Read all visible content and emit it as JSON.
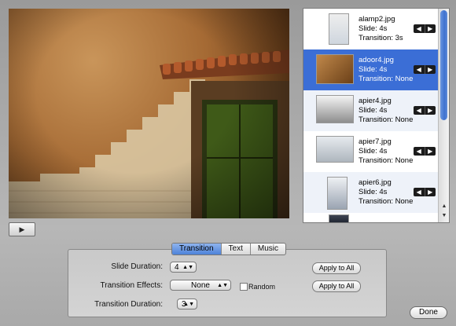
{
  "slides": [
    {
      "name": "alamp2.jpg",
      "slide": "Slide: 4s",
      "transition": "Transition: 3s",
      "selected": false
    },
    {
      "name": "adoor4.jpg",
      "slide": "Slide: 4s",
      "transition": "Transition: None",
      "selected": true
    },
    {
      "name": "apier4.jpg",
      "slide": "Slide: 4s",
      "transition": "Transition: None",
      "selected": false
    },
    {
      "name": "apier7.jpg",
      "slide": "Slide: 4s",
      "transition": "Transition: None",
      "selected": false
    },
    {
      "name": "apier6.jpg",
      "slide": "Slide: 4s",
      "transition": "Transition: None",
      "selected": false
    }
  ],
  "arrow_left": "◀",
  "arrow_right": "▶",
  "tabs": [
    "Transition",
    "Text",
    "Music"
  ],
  "active_tab": "Transition",
  "settings": {
    "slide_duration_label": "Slide Duration:",
    "slide_duration_value": "4",
    "transition_effects_label": "Transition Effects:",
    "transition_effects_value": "None",
    "random_label": "Random",
    "transition_duration_label": "Transition Duration:",
    "transition_duration_value": "3",
    "apply_label": "Apply to All"
  },
  "done_label": "Done",
  "play_icon": "▶",
  "popup_chevron": "▲▼",
  "scroll_up": "▲",
  "scroll_down": "▼"
}
